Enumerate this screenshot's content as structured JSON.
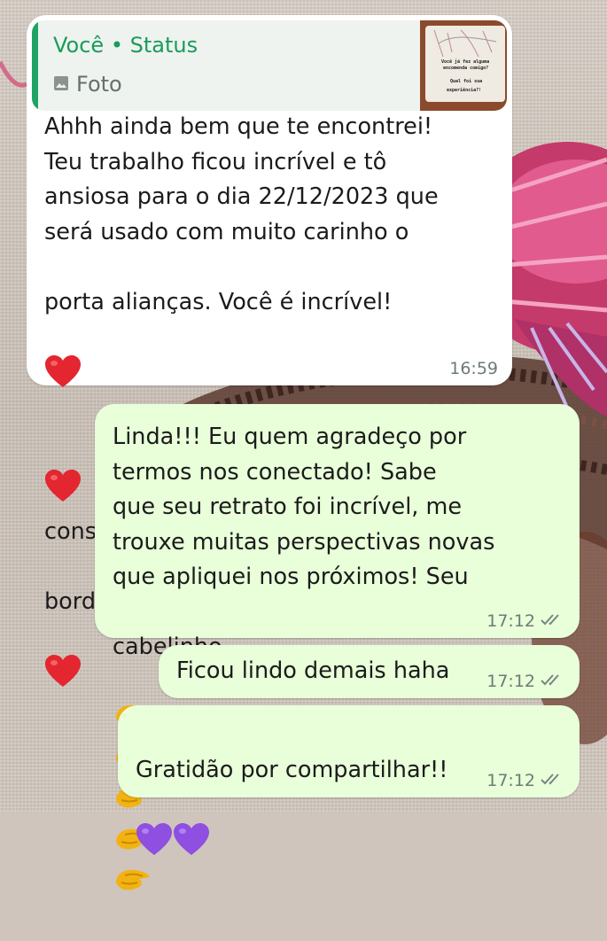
{
  "chat": {
    "incoming": {
      "quote": {
        "author": "Você • Status",
        "type_label": "Foto",
        "thumb_lines": [
          "Você já fez alguma",
          "encomenda comigo?",
          "Qual foi sua",
          "experiência?!"
        ],
        "icon": "photo-icon"
      },
      "lines": [
        "Ahhh ainda bem que te encontrei!",
        "Teu trabalho ficou incrível e tô",
        "ansiosa para o dia 22/12/2023 que",
        "será usado com muito carinho o",
        "porta alianças. Você é incrível!",
        "consegue captar detalhes e",
        "bordar amor!"
      ],
      "time": "16:59"
    },
    "outgoing": [
      {
        "lines": [
          "Linda!!! Eu quem agradeço por",
          "termos nos conectado! Sabe",
          "que seu retrato foi incrível, me",
          "trouxe muitas perspectivas novas",
          "que apliquei nos próximos! Seu",
          "cabelinho"
        ],
        "time": "17:12"
      },
      {
        "text": "Ficou lindo demais haha",
        "time": "17:12"
      },
      {
        "text": "Gratidão por compartilhar!!",
        "time": "17:12"
      }
    ]
  },
  "colors": {
    "outgoing_bubble": "#e8ffd9",
    "incoming_bubble": "#ffffff",
    "quote_accent": "#1fa463",
    "heart": "#e3262f",
    "purple_heart": "#8f4fe0",
    "pinch_hand": "#f2b312"
  },
  "icons": [
    "red-heart-icon",
    "pinched-fingers-icon",
    "purple-heart-icon",
    "double-check-icon"
  ]
}
